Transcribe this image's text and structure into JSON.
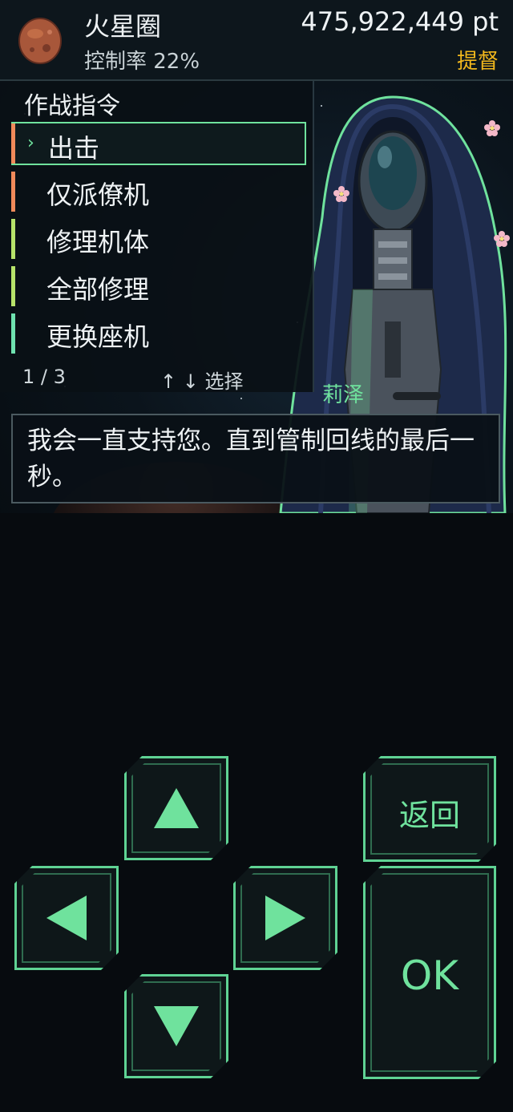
{
  "header": {
    "area_name": "火星圈",
    "control_rate": "控制率 22%",
    "points": "475,922,449 pt",
    "rank": "提督"
  },
  "command_menu": {
    "title": "作战指令",
    "items": [
      {
        "label": "出击",
        "selected": true,
        "color": "#f08a5a"
      },
      {
        "label": "仅派僚机",
        "selected": false,
        "color": "#f08a5a"
      },
      {
        "label": "修理机体",
        "selected": false,
        "color": "#b7e36a"
      },
      {
        "label": "全部修理",
        "selected": false,
        "color": "#b7e36a"
      },
      {
        "label": "更换座机",
        "selected": false,
        "color": "#6fe2b0"
      }
    ],
    "page": "1 / 3",
    "hint": "↑ ↓ 选择"
  },
  "character": {
    "name": "莉泽"
  },
  "dialogue": {
    "text": "我会一直支持您。直到管制回线的最后一秒。"
  },
  "controls": {
    "up_icon": "arrow-up-icon",
    "down_icon": "arrow-down-icon",
    "left_icon": "arrow-left-icon",
    "right_icon": "arrow-right-icon",
    "back_label": "返回",
    "ok_label": "OK"
  },
  "colors": {
    "accent": "#6fe29d",
    "rank": "#f2b81c",
    "background": "#070b0f"
  }
}
